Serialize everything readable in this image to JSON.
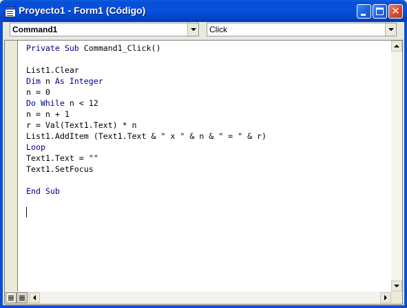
{
  "window": {
    "title": "Proyecto1 - Form1 (Código)",
    "title_bar_color": "#0a4dd6",
    "close_button_color": "#d7492b"
  },
  "toolbar": {
    "object_combo_value": "Command1",
    "procedure_combo_value": "Click"
  },
  "code": {
    "keyword_color": "#00008b",
    "lines": [
      [
        {
          "t": "Private Sub ",
          "kw": true
        },
        {
          "t": "Command1_Click()",
          "kw": false
        }
      ],
      [],
      [
        {
          "t": "List1.Clear",
          "kw": false
        }
      ],
      [
        {
          "t": "Dim ",
          "kw": true
        },
        {
          "t": "n ",
          "kw": false
        },
        {
          "t": "As Integer",
          "kw": true
        }
      ],
      [
        {
          "t": "n = 0",
          "kw": false
        }
      ],
      [
        {
          "t": "Do While ",
          "kw": true
        },
        {
          "t": "n < 12",
          "kw": false
        }
      ],
      [
        {
          "t": "n = n + 1",
          "kw": false
        }
      ],
      [
        {
          "t": "r = Val(Text1.Text) * n",
          "kw": false
        }
      ],
      [
        {
          "t": "List1.AddItem (Text1.Text & \" x \" & n & \" = \" & r)",
          "kw": false
        }
      ],
      [
        {
          "t": "Loop",
          "kw": true
        }
      ],
      [
        {
          "t": "Text1.Text = \"\"",
          "kw": false
        }
      ],
      [
        {
          "t": "Text1.SetFocus",
          "kw": false
        }
      ],
      [],
      [
        {
          "t": "End Sub",
          "kw": true
        }
      ]
    ]
  },
  "icons": {
    "app": "vb-code-window-icon",
    "minimize": "minimize-icon",
    "maximize": "maximize-icon",
    "close": "close-icon",
    "close_glyph": "✕"
  }
}
